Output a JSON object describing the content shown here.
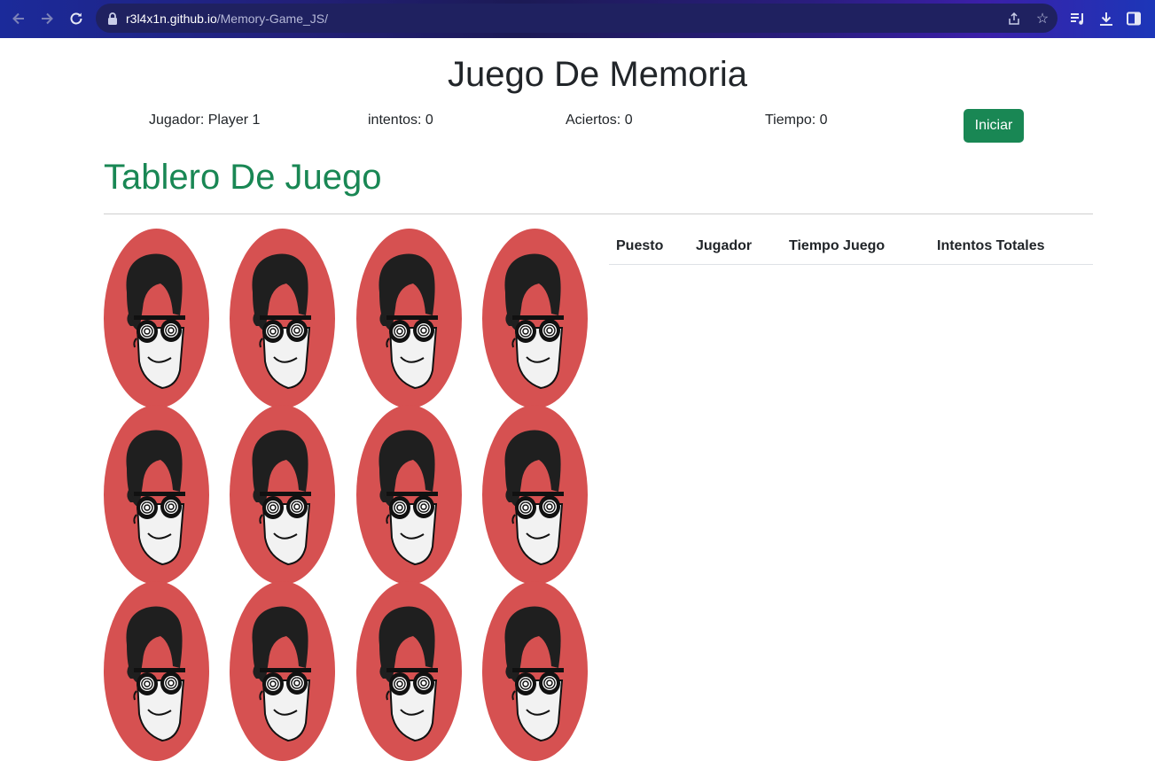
{
  "browser": {
    "url_host": "r3l4x1n.github.io",
    "url_path": "/Memory-Game_JS/"
  },
  "page": {
    "title": "Juego De Memoria",
    "stats": {
      "player": "Jugador: Player 1",
      "attempts": "intentos: 0",
      "hits": "Aciertos: 0",
      "time": "Tiempo: 0"
    },
    "start_label": "Iniciar",
    "board_title": "Tablero De Juego",
    "table_headers": [
      "Puesto",
      "Jugador",
      "Tiempo Juego",
      "Intentos Totales"
    ]
  },
  "colors": {
    "accent": "#198754",
    "card_back": "#d65151"
  },
  "cards": {
    "icon": "face-with-spiral-glasses-icon",
    "count_visible": 12
  }
}
